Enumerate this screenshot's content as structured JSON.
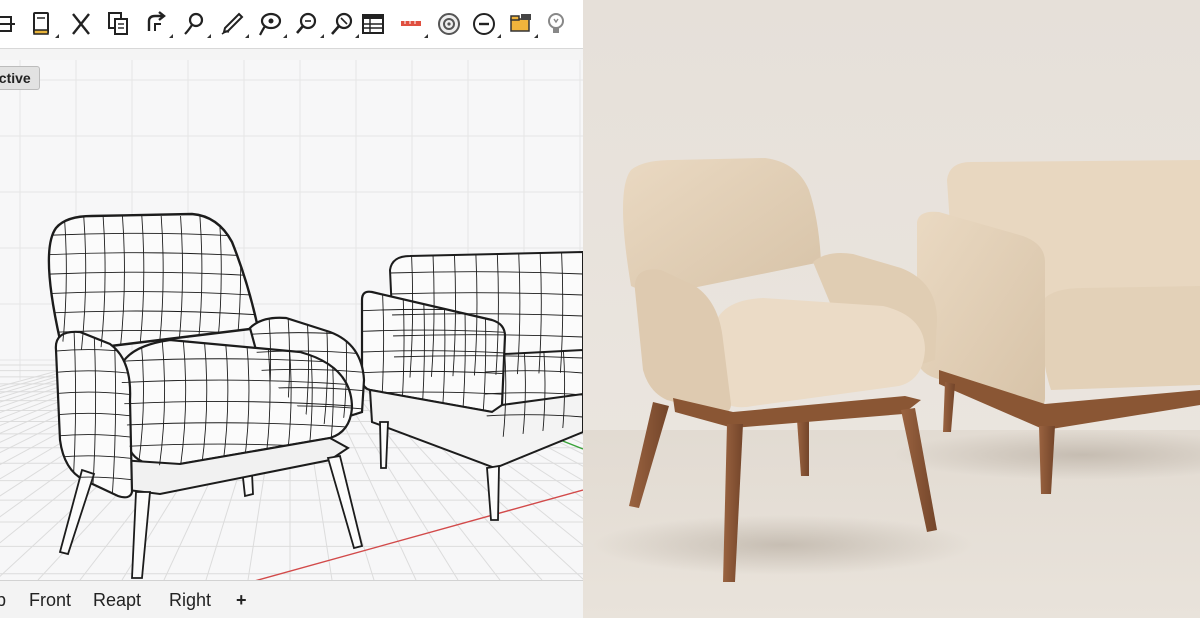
{
  "viewport": {
    "label": "ective",
    "label_partial": true
  },
  "view_tabs": [
    "p",
    "Front",
    "Reapt",
    "Right",
    "+"
  ],
  "toolbar": {
    "tools": [
      {
        "icon": "shape-icon"
      },
      {
        "icon": "document-icon"
      },
      {
        "icon": "cut-icon"
      },
      {
        "icon": "copy-icon"
      },
      {
        "icon": "undo-icon"
      },
      {
        "icon": "lasso-icon"
      },
      {
        "icon": "pen-icon"
      },
      {
        "icon": "lasso-select-icon"
      },
      {
        "icon": "zoom-icon"
      },
      {
        "icon": "zoom-window-icon"
      },
      {
        "icon": "table-icon"
      },
      {
        "icon": "ruler-icon"
      },
      {
        "icon": "target-icon"
      },
      {
        "icon": "zoom-out-icon"
      },
      {
        "icon": "folder-icon"
      },
      {
        "icon": "bulb-icon"
      }
    ]
  },
  "colors": {
    "wire": "#1c1c1c",
    "grid": "#dcdcdc",
    "axis_x": "#d24a4a",
    "axis_y": "#3aa33a",
    "fabric": "#e5d6c1",
    "wood": "#8a5634",
    "backdrop": "#e9e4de"
  }
}
